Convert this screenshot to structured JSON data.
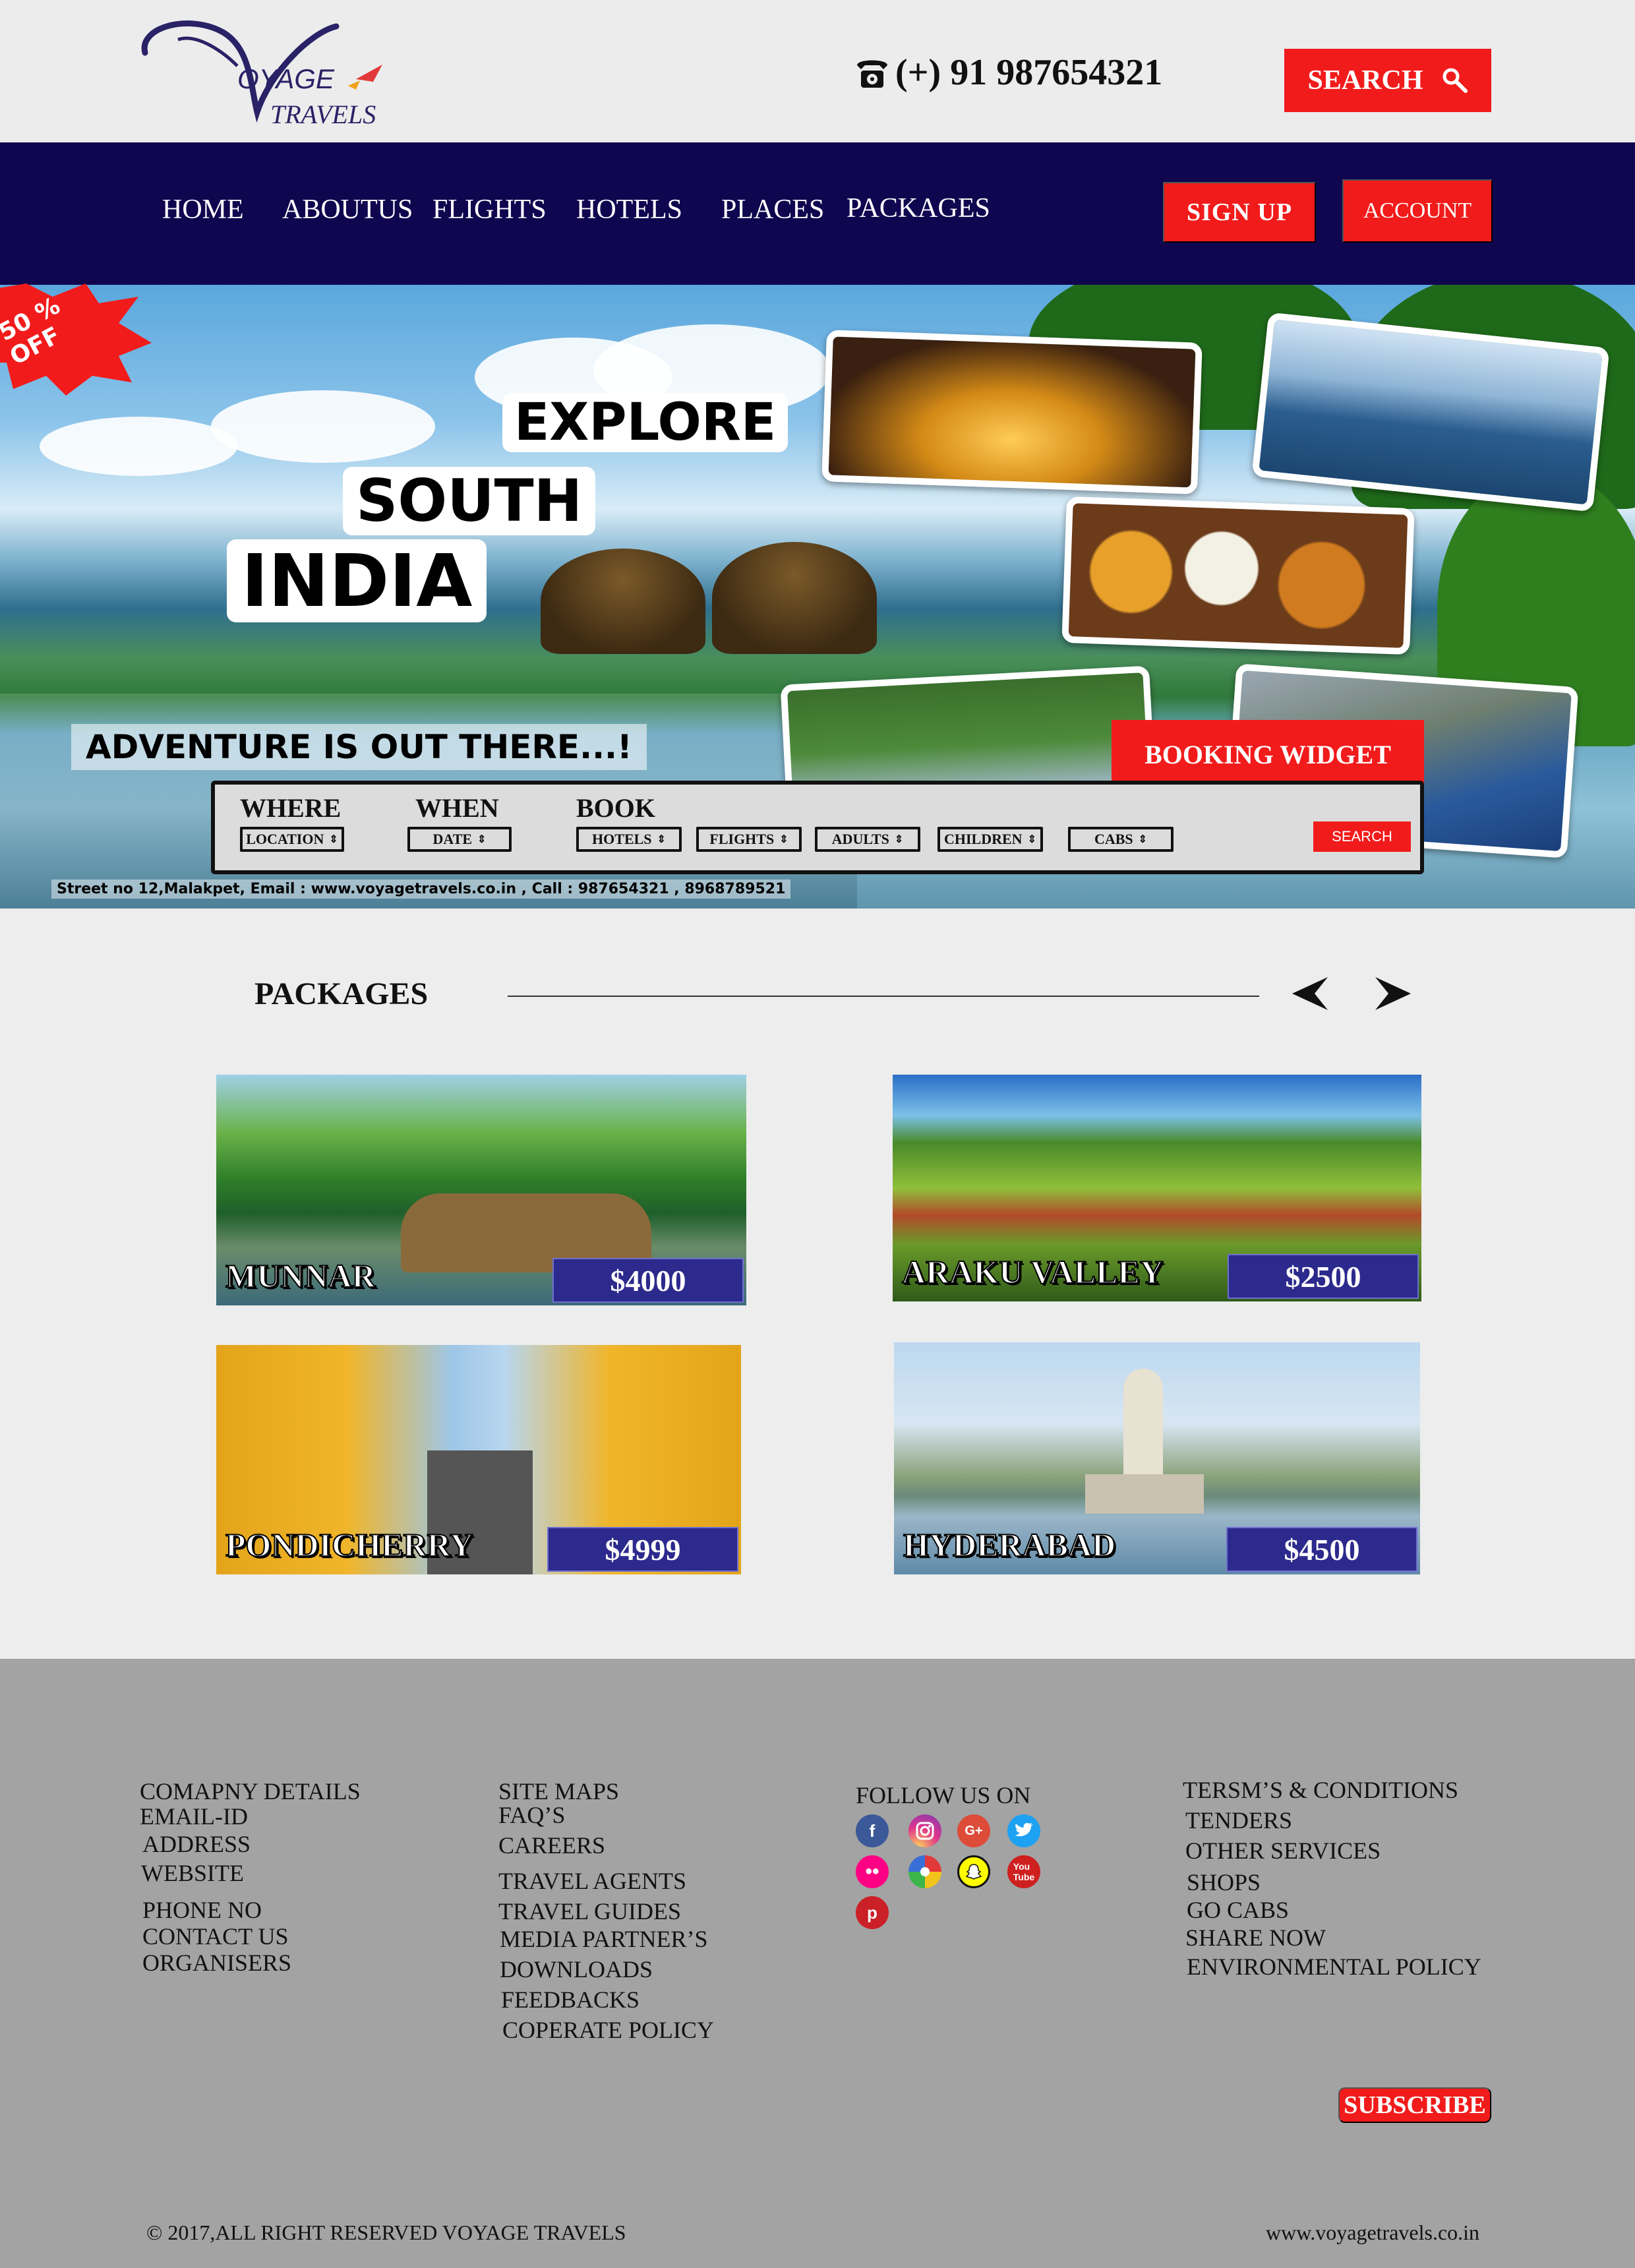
{
  "brand": {
    "logo_line1": "OYAGE",
    "logo_line2": "RAVELS",
    "logo_initial_1": "V",
    "logo_initial_2": "T"
  },
  "header": {
    "phone": "(+) 91 987654321",
    "search_label": "SEARCH"
  },
  "nav": {
    "items": [
      "HOME",
      "ABOUTUS",
      "FLIGHTS",
      "HOTELS",
      "PLACES",
      "PACKAGES"
    ],
    "signup_label": "SIGN UP",
    "account_label": "ACCOUNT"
  },
  "hero": {
    "discount_line1": "50 %",
    "discount_line2": "OFF",
    "explore": "EXPLORE",
    "south": "SOUTH",
    "india": "INDIA",
    "adventure": "ADVENTURE IS OUT THERE...!",
    "booking_widget_label": "BOOKING WIDGET",
    "footer_line": "Street no 12,Malakpet, Email : www.voyagetravels.co.in , Call : 987654321 , 8968789521"
  },
  "booking": {
    "where_label": "WHERE",
    "when_label": "WHEN",
    "book_label": "BOOK",
    "location": "LOCATION",
    "date": "DATE",
    "hotels": "HOTELS",
    "flights": "FLIGHTS",
    "adults": "ADULTS",
    "children": "CHILDREN",
    "cabs": "CABS",
    "search_label": "SEARCH"
  },
  "packages": {
    "title": "PACKAGES",
    "cards": [
      {
        "name": "MUNNAR",
        "price": "$4000"
      },
      {
        "name": "ARAKU VALLEY",
        "price": "$2500"
      },
      {
        "name": "PONDICHERRY",
        "price": "$4999"
      },
      {
        "name": "HYDERABAD",
        "price": "$4500"
      }
    ]
  },
  "footer": {
    "col1": [
      "COMAPNY DETAILS",
      "EMAIL-ID",
      "ADDRESS",
      "WEBSITE",
      "PHONE NO",
      "CONTACT US",
      "ORGANISERS"
    ],
    "col2": [
      "SITE MAPS",
      "FAQ’S",
      "CAREERS",
      "TRAVEL AGENTS",
      "TRAVEL GUIDES",
      "MEDIA PARTNER’S",
      "DOWNLOADS",
      "FEEDBACKS",
      "COPERATE POLICY"
    ],
    "follow_label": "FOLLOW US ON",
    "social_icons": [
      "facebook-icon",
      "instagram-icon",
      "google-plus-icon",
      "twitter-icon",
      "flickr-icon",
      "picasa-icon",
      "snapchat-icon",
      "youtube-icon",
      "pinterest-icon"
    ],
    "col4": [
      "TERSM’S & CONDITIONS",
      "TENDERS",
      "OTHER SERVICES",
      "SHOPS",
      "GO CABS",
      "SHARE NOW",
      "ENVIRONMENTAL POLICY"
    ],
    "subscribe_label": "SUBSCRIBE",
    "copyright": "2017,ALL RIGHT RESERVED VOYAGE TRAVELS",
    "site_url": "www.voyagetravels.co.in"
  },
  "colors": {
    "accent": "#f21b1b",
    "nav_bg": "#10064f",
    "price_bg": "#2c2a8c",
    "footer_bg": "#a3a3a3",
    "page_bg": "#ededed"
  }
}
